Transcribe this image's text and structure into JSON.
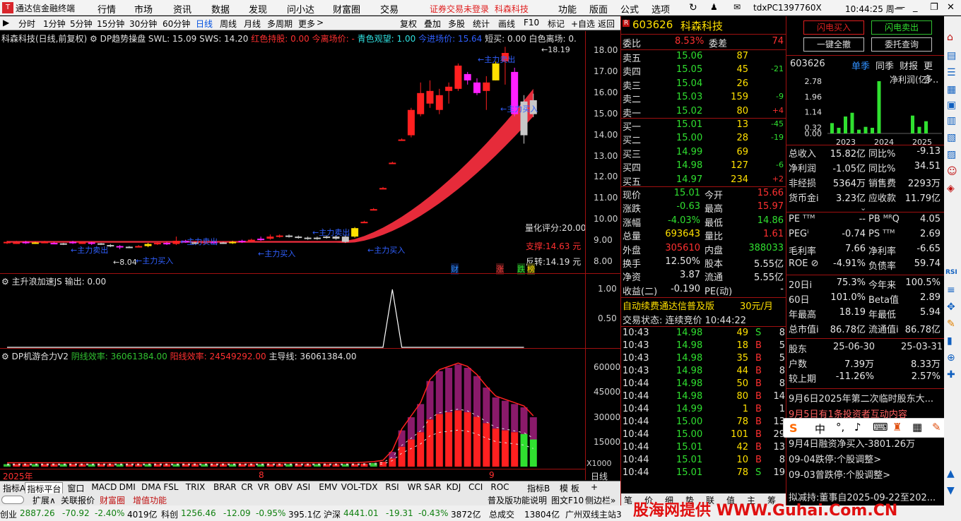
{
  "titlebar": {
    "app_title": "通达信金融终端",
    "menus": [
      "行情",
      "市场",
      "资讯",
      "数据",
      "发现",
      "问小达",
      "财富圈",
      "交易"
    ],
    "login_notice": "证券交易未登录",
    "stock_name": "科森科技",
    "right_menus": [
      "功能",
      "版面",
      "公式",
      "选项"
    ],
    "user_id": "tdxPC1397760X",
    "clock": "10:44:25 周一"
  },
  "toolbar": {
    "periods": [
      "分时",
      "1分钟",
      "5分钟",
      "15分钟",
      "30分钟",
      "60分钟",
      "日线",
      "周线",
      "月线",
      "多周期",
      "更多"
    ],
    "actions": [
      "复权",
      "叠加",
      "多股",
      "统计",
      "画线",
      "F10",
      "标记",
      "+自选",
      "返回"
    ]
  },
  "main_chart": {
    "title": "科森科技(日线,前复权)",
    "indicator_line": "DP趋势操盘 SWL: 15.09 SWS: 14.20",
    "red_hold": "红色持股: 0.00",
    "today_exit": "今离场价: -",
    "cyan_watch": "青色观望: 1.00",
    "enter_price": "今进场价: 15.64",
    "short_watch": "短买: 0.00",
    "white_exit": "白色离场: 0.",
    "y_labels": [
      "18.00",
      "17.00",
      "16.00",
      "15.00",
      "14.00",
      "13.00",
      "12.00",
      "11.00",
      "10.00",
      "9.00",
      "8.00"
    ],
    "high_mark": "18.19",
    "low_mark": "8.04",
    "quant_score": "量化评分:20.00",
    "support": "支撑:14.63 元",
    "reversal": "反转:14.19 元",
    "events": [
      "财",
      "涨",
      "跌",
      "榜"
    ],
    "annotations": {
      "sell": "←主力卖出",
      "buy": "←主力买入"
    }
  },
  "accel_panel": {
    "title": "主升浪加速JS 输出: 0.00",
    "y_labels": [
      "1.00",
      "0.50"
    ]
  },
  "dp_panel": {
    "title": "DP机游合力V2",
    "yin_eff": "阴线效率: 36061384.00",
    "yang_eff": "阳线效率: 24549292.00",
    "main_line": "主导线: 36061384.00",
    "y_labels": [
      "60000",
      "45000",
      "30000",
      "15000"
    ],
    "unit": "X1000"
  },
  "x_axis": {
    "labels": [
      "2025年",
      "8",
      "9"
    ],
    "period": "日线"
  },
  "chart_data": {
    "type": "candlestick",
    "title": "科森科技(日线,前复权)",
    "y_range": [
      8,
      18.3
    ],
    "candles": [
      {
        "o": 8.9,
        "c": 8.95,
        "h": 9.0,
        "l": 8.85,
        "color": "red"
      },
      {
        "o": 8.9,
        "c": 8.92,
        "h": 9.0,
        "l": 8.85,
        "color": "red"
      },
      {
        "o": 8.95,
        "c": 8.9,
        "h": 9.0,
        "l": 8.85,
        "color": "magenta"
      },
      {
        "o": 8.9,
        "c": 8.92,
        "h": 8.95,
        "l": 8.85,
        "color": "yellow"
      },
      {
        "o": 8.92,
        "c": 8.95,
        "h": 9.0,
        "l": 8.9,
        "color": "red"
      },
      {
        "o": 8.9,
        "c": 8.88,
        "h": 8.95,
        "l": 8.85,
        "color": "magenta"
      },
      {
        "o": 8.88,
        "c": 8.85,
        "h": 8.9,
        "l": 8.8,
        "color": "grey"
      },
      {
        "o": 8.9,
        "c": 8.95,
        "h": 9.0,
        "l": 8.85,
        "color": "magenta"
      },
      {
        "o": 8.9,
        "c": 8.92,
        "h": 8.95,
        "l": 8.85,
        "color": "red"
      },
      {
        "o": 8.92,
        "c": 8.88,
        "h": 8.95,
        "l": 8.8,
        "color": "magenta"
      },
      {
        "o": 8.88,
        "c": 8.85,
        "h": 8.9,
        "l": 8.8,
        "color": "grey"
      },
      {
        "o": 8.8,
        "c": 8.75,
        "h": 8.85,
        "l": 8.7,
        "color": "grey"
      },
      {
        "o": 8.75,
        "c": 8.7,
        "h": 8.8,
        "l": 8.6,
        "color": "magenta"
      },
      {
        "o": 8.7,
        "c": 8.72,
        "h": 8.75,
        "l": 8.65,
        "color": "grey"
      },
      {
        "o": 8.72,
        "c": 8.75,
        "h": 8.8,
        "l": 8.7,
        "color": "red"
      },
      {
        "o": 8.75,
        "c": 8.85,
        "h": 8.9,
        "l": 8.7,
        "color": "yellow"
      },
      {
        "o": 8.85,
        "c": 8.9,
        "h": 8.95,
        "l": 8.8,
        "color": "red"
      },
      {
        "o": 8.9,
        "c": 8.85,
        "h": 8.95,
        "l": 8.8,
        "color": "magenta"
      },
      {
        "o": 8.85,
        "c": 9.0,
        "h": 9.2,
        "l": 8.8,
        "color": "red"
      },
      {
        "o": 9.0,
        "c": 8.92,
        "h": 9.05,
        "l": 8.9,
        "color": "magenta"
      },
      {
        "o": 8.92,
        "c": 8.9,
        "h": 8.95,
        "l": 8.85,
        "color": "grey"
      },
      {
        "o": 8.9,
        "c": 8.95,
        "h": 9.0,
        "l": 8.85,
        "color": "red"
      },
      {
        "o": 8.95,
        "c": 8.92,
        "h": 9.0,
        "l": 8.9,
        "color": "magenta"
      },
      {
        "o": 8.92,
        "c": 8.9,
        "h": 8.95,
        "l": 8.85,
        "color": "grey"
      },
      {
        "o": 8.9,
        "c": 8.95,
        "h": 9.0,
        "l": 8.85,
        "color": "yellow"
      },
      {
        "o": 8.95,
        "c": 9.0,
        "h": 9.05,
        "l": 8.9,
        "color": "magenta"
      },
      {
        "o": 9.0,
        "c": 9.05,
        "h": 9.1,
        "l": 8.95,
        "color": "red"
      },
      {
        "o": 9.05,
        "c": 9.1,
        "h": 9.2,
        "l": 9.0,
        "color": "magenta"
      },
      {
        "o": 9.1,
        "c": 9.2,
        "h": 9.3,
        "l": 9.05,
        "color": "red"
      },
      {
        "o": 9.2,
        "c": 9.25,
        "h": 9.3,
        "l": 9.15,
        "color": "red"
      },
      {
        "o": 9.25,
        "c": 9.2,
        "h": 9.3,
        "l": 9.15,
        "color": "grey"
      },
      {
        "o": 9.2,
        "c": 9.15,
        "h": 9.25,
        "l": 9.1,
        "color": "grey"
      },
      {
        "o": 9.15,
        "c": 9.1,
        "h": 9.2,
        "l": 9.05,
        "color": "grey"
      },
      {
        "o": 9.1,
        "c": 9.15,
        "h": 9.2,
        "l": 9.05,
        "color": "grey"
      },
      {
        "o": 9.15,
        "c": 9.2,
        "h": 9.25,
        "l": 9.1,
        "color": "grey"
      },
      {
        "o": 9.2,
        "c": 9.1,
        "h": 9.25,
        "l": 9.05,
        "color": "grey"
      },
      {
        "o": 8.95,
        "c": 9.2,
        "h": 9.25,
        "l": 8.9,
        "color": "grey"
      },
      {
        "o": 9.2,
        "c": 9.6,
        "h": 9.65,
        "l": 9.15,
        "color": "yellow"
      },
      {
        "o": 9.9,
        "c": 9.9,
        "h": 9.95,
        "l": 9.85,
        "color": "red"
      },
      {
        "o": 10.5,
        "c": 10.5,
        "h": 10.55,
        "l": 10.45,
        "color": "red"
      },
      {
        "o": 11.5,
        "c": 11.5,
        "h": 11.55,
        "l": 11.45,
        "color": "red"
      },
      {
        "o": 12.7,
        "c": 12.7,
        "h": 12.75,
        "l": 12.65,
        "color": "red"
      },
      {
        "o": 13.8,
        "c": 13.8,
        "h": 13.85,
        "l": 13.75,
        "color": "red"
      },
      {
        "o": 14.0,
        "c": 15.2,
        "h": 15.3,
        "l": 13.9,
        "color": "red"
      },
      {
        "o": 15.0,
        "c": 16.0,
        "h": 16.5,
        "l": 14.9,
        "color": "red"
      },
      {
        "o": 15.5,
        "c": 16.1,
        "h": 16.6,
        "l": 15.3,
        "color": "red"
      },
      {
        "o": 15.2,
        "c": 15.9,
        "h": 16.2,
        "l": 15.0,
        "color": "red"
      },
      {
        "o": 16.1,
        "c": 16.3,
        "h": 16.5,
        "l": 15.5,
        "color": "red"
      },
      {
        "o": 16.2,
        "c": 17.3,
        "h": 17.4,
        "l": 16.1,
        "color": "red"
      },
      {
        "o": 16.9,
        "c": 16.6,
        "h": 17.0,
        "l": 16.4,
        "color": "magenta"
      },
      {
        "o": 16.5,
        "c": 16.0,
        "h": 16.7,
        "l": 15.9,
        "color": "magenta"
      },
      {
        "o": 16.1,
        "c": 16.5,
        "h": 16.8,
        "l": 15.2,
        "color": "red"
      },
      {
        "o": 16.6,
        "c": 17.4,
        "h": 17.5,
        "l": 16.6,
        "color": "yellow"
      },
      {
        "o": 17.5,
        "c": 17.9,
        "h": 18.19,
        "l": 16.4,
        "color": "red"
      },
      {
        "o": 17.0,
        "c": 15.0,
        "h": 17.2,
        "l": 14.9,
        "color": "magenta"
      },
      {
        "o": 15.6,
        "c": 14.0,
        "h": 15.9,
        "l": 13.6,
        "color": "grey"
      },
      {
        "o": 15.0,
        "c": 15.66,
        "h": 15.97,
        "l": 14.86,
        "color": "grey"
      }
    ]
  },
  "quote": {
    "code": "603626",
    "name": "科森科技",
    "webi_label": "委比",
    "webi": "8.53%",
    "weicha_label": "委差",
    "weicha": "74",
    "sell_levels": [
      {
        "label": "卖五",
        "price": "15.06",
        "vol": "87",
        "chg": ""
      },
      {
        "label": "卖四",
        "price": "15.05",
        "vol": "45",
        "chg": "-21"
      },
      {
        "label": "卖三",
        "price": "15.04",
        "vol": "26",
        "chg": ""
      },
      {
        "label": "卖二",
        "price": "15.03",
        "vol": "159",
        "chg": "-9"
      },
      {
        "label": "卖一",
        "price": "15.02",
        "vol": "80",
        "chg": "+4"
      }
    ],
    "buy_levels": [
      {
        "label": "买一",
        "price": "15.01",
        "vol": "13",
        "chg": "-45"
      },
      {
        "label": "买二",
        "price": "15.00",
        "vol": "28",
        "chg": "-19"
      },
      {
        "label": "买三",
        "price": "14.99",
        "vol": "69",
        "chg": ""
      },
      {
        "label": "买四",
        "price": "14.98",
        "vol": "127",
        "chg": "-6"
      },
      {
        "label": "买五",
        "price": "14.97",
        "vol": "234",
        "chg": "+2"
      }
    ],
    "stats": [
      {
        "l1": "现价",
        "v1": "15.01",
        "l2": "今开",
        "v2": "15.66",
        "c1": "grn",
        "c2": "rd"
      },
      {
        "l1": "涨跌",
        "v1": "-0.63",
        "l2": "最高",
        "v2": "15.97",
        "c1": "grn",
        "c2": "rd"
      },
      {
        "l1": "涨幅",
        "v1": "-4.03%",
        "l2": "最低",
        "v2": "14.86",
        "c1": "grn",
        "c2": "grn"
      },
      {
        "l1": "总量",
        "v1": "693643",
        "l2": "量比",
        "v2": "1.61",
        "c1": "yel",
        "c2": "rd"
      },
      {
        "l1": "外盘",
        "v1": "305610",
        "l2": "内盘",
        "v2": "388033",
        "c1": "rd",
        "c2": "grn"
      },
      {
        "l1": "换手",
        "v1": "12.50%",
        "l2": "股本",
        "v2": "5.55亿",
        "c1": "wht",
        "c2": "wht"
      },
      {
        "l1": "净资",
        "v1": "3.87",
        "l2": "流通",
        "v2": "5.55亿",
        "c1": "wht",
        "c2": "wht"
      },
      {
        "l1": "收益(二)",
        "v1": "-0.190",
        "l2": "PE(动)",
        "v2": "-",
        "c1": "wht",
        "c2": "wht"
      }
    ],
    "ad_text": "自动续费通达信普及版",
    "ad_price": "30元/月",
    "trade_state": "交易状态: 连续竞价 10:44:22",
    "ticks": [
      {
        "t": "10:43",
        "p": "14.98",
        "v": "49",
        "s": "S",
        "n": "8"
      },
      {
        "t": "10:43",
        "p": "14.98",
        "v": "18",
        "s": "B",
        "n": "5"
      },
      {
        "t": "10:43",
        "p": "14.98",
        "v": "35",
        "s": "B",
        "n": "5"
      },
      {
        "t": "10:43",
        "p": "14.98",
        "v": "44",
        "s": "B",
        "n": "8"
      },
      {
        "t": "10:44",
        "p": "14.98",
        "v": "50",
        "s": "B",
        "n": "8"
      },
      {
        "t": "10:44",
        "p": "14.98",
        "v": "80",
        "s": "B",
        "n": "14"
      },
      {
        "t": "10:44",
        "p": "14.99",
        "v": "1",
        "s": "B",
        "n": "1"
      },
      {
        "t": "10:44",
        "p": "15.00",
        "v": "78",
        "s": "B",
        "n": "13"
      },
      {
        "t": "10:44",
        "p": "15.00",
        "v": "101",
        "s": "B",
        "n": "29"
      },
      {
        "t": "10:44",
        "p": "15.01",
        "v": "42",
        "s": "B",
        "n": "13"
      },
      {
        "t": "10:44",
        "p": "15.01",
        "v": "10",
        "s": "B",
        "n": "8"
      },
      {
        "t": "10:44",
        "p": "15.01",
        "v": "78",
        "s": "S",
        "n": "19"
      }
    ],
    "bottom_tabs": [
      "笔",
      "价",
      "细",
      "势",
      "联",
      "值",
      "主",
      "筹"
    ]
  },
  "fin": {
    "btn_flash_buy": "闪电买入",
    "btn_flash_sell": "闪电卖出",
    "btn_allin": "一键全撤",
    "btn_query": "委托查询",
    "code": "603626",
    "tabs": [
      "单季",
      "同季",
      "财报",
      "更多.."
    ],
    "metric_label": "净利润(亿)",
    "y_labels": [
      "2.78",
      "1.96",
      "1.14",
      "0.32",
      "0.00"
    ],
    "years": [
      "2023",
      "2024",
      "2025"
    ],
    "bars": [
      0.55,
      0.3,
      0.9,
      1.1,
      0.2,
      0.35,
      0.3,
      2.78,
      0.0,
      0.0,
      0.0,
      0.0,
      0.95,
      0.35,
      0.65,
      0.0
    ],
    "rows1": [
      {
        "l1": "总收入",
        "v1": "15.82亿",
        "l2": "同比%",
        "v2": "-9.13"
      },
      {
        "l1": "净利润",
        "v1": "-1.05亿",
        "l2": "同比%",
        "v2": "34.51"
      },
      {
        "l1": "非经损",
        "v1": "5364万",
        "l2": "销售费",
        "v2": "2293万"
      },
      {
        "l1": "货币金i",
        "v1": "3.23亿",
        "l2": "应收款",
        "v2": "11.79亿"
      }
    ],
    "rows2": [
      {
        "l1": "PE ᵀᵀᴹ",
        "v1": "--",
        "l2": "PB ᴹᴿQ",
        "v2": "4.05"
      },
      {
        "l1": "PEGⁱ",
        "v1": "-0.74",
        "l2": "PS ᵀᵀᴹ",
        "v2": "2.69"
      },
      {
        "l1": "毛利率",
        "v1": "7.66",
        "l2": "净利率",
        "v2": "-6.65"
      },
      {
        "l1": "ROE ⊘",
        "v1": "-4.91%",
        "l2": "负债率",
        "v2": "59.74"
      }
    ],
    "rows3": [
      {
        "l1": "20日i",
        "v1": "75.3%",
        "l2": "今年来",
        "v2": "100.5%"
      },
      {
        "l1": "60日",
        "v1": "101.0%",
        "l2": "Beta值",
        "v2": "2.89"
      },
      {
        "l1": "年最高",
        "v1": "18.19",
        "l2": "年最低",
        "v2": "5.94"
      },
      {
        "l1": "总市值i",
        "v1": "86.78亿",
        "l2": "流通值i",
        "v2": "86.78亿"
      }
    ],
    "holder_head": {
      "l": "股东",
      "d1": "25-06-30",
      "d2": "25-03-31"
    },
    "holder_rows": [
      {
        "l": "户数",
        "v1": "7.39万",
        "v2": "8.33万"
      },
      {
        "l": "较上期",
        "v1": "-11.26%",
        "v2": "2.57%"
      }
    ],
    "news": [
      "9月6日2025年第二次临时股东大...",
      "9月5日有1条投资者互动内容",
      "9月4日融资净买入-3801.26万",
      "09-04跌停:个股调整>",
      "09-03曾跌停:个股调整>",
      "拟减持:董事自2025-09-22至202..."
    ],
    "ime": "中"
  },
  "right_toolbar": [
    "RSI"
  ],
  "bottom": {
    "tabs": [
      "指标A",
      "指标平台",
      "窗口",
      "MACD",
      "DMI",
      "DMA",
      "FSL",
      "TRIX",
      "BRAR",
      "CR",
      "VR",
      "OBV",
      "ASI",
      "EMV",
      "VOL-TDX",
      "RSI",
      "WR",
      "SAR",
      "KDJ",
      "CCI",
      "ROC",
      "指标B",
      "模 板",
      "+"
    ],
    "tabs2": [
      "扩展∧",
      "关联报价",
      "财富圈",
      "增值功能"
    ],
    "tabs2_right": [
      "普及版功能说明",
      "图文F10",
      "侧边栏»"
    ]
  },
  "status": {
    "items": [
      {
        "name": "创业",
        "val": "2887.26",
        "chg": "-70.92",
        "pct": "-2.40%",
        "amt": "4019亿"
      },
      {
        "name": "科创",
        "val": "1256.46",
        "chg": "-12.09",
        "pct": "-0.95%",
        "amt": "395.1亿"
      },
      {
        "name": "沪深",
        "val": "4441.01",
        "chg": "-19.31",
        "pct": "-0.43%",
        "amt": "3872亿"
      }
    ],
    "total_label": "总成交",
    "total_val": "13804亿",
    "server": "广州双线主站3",
    "watermark": "股海网提供 WWW.Guhai.Com.CN"
  }
}
